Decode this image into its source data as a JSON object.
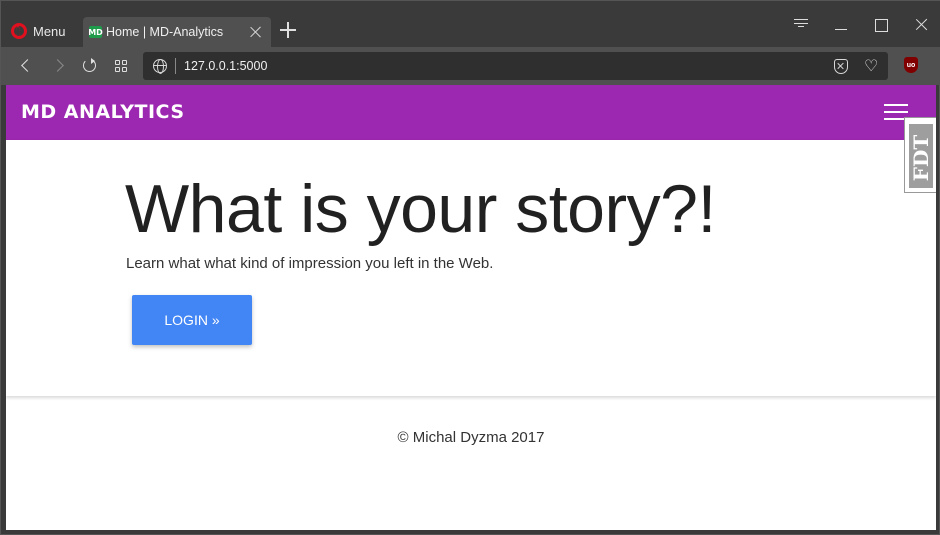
{
  "browser": {
    "menu_label": "Menu",
    "tab": {
      "favicon_text": "MD",
      "title": "Home | MD-Analytics"
    },
    "url": "127.0.0.1:5000"
  },
  "site": {
    "brand": "MD ANALYTICS",
    "badge_text": "FDT",
    "hero": {
      "headline": "What is your story?!",
      "lead": "Learn what what kind of impression you left in the Web.",
      "login_label": "LOGIN »"
    },
    "footer": "© Michal Dyzma 2017"
  },
  "colors": {
    "navbar": "#9c27b0",
    "button": "#4285f4"
  }
}
